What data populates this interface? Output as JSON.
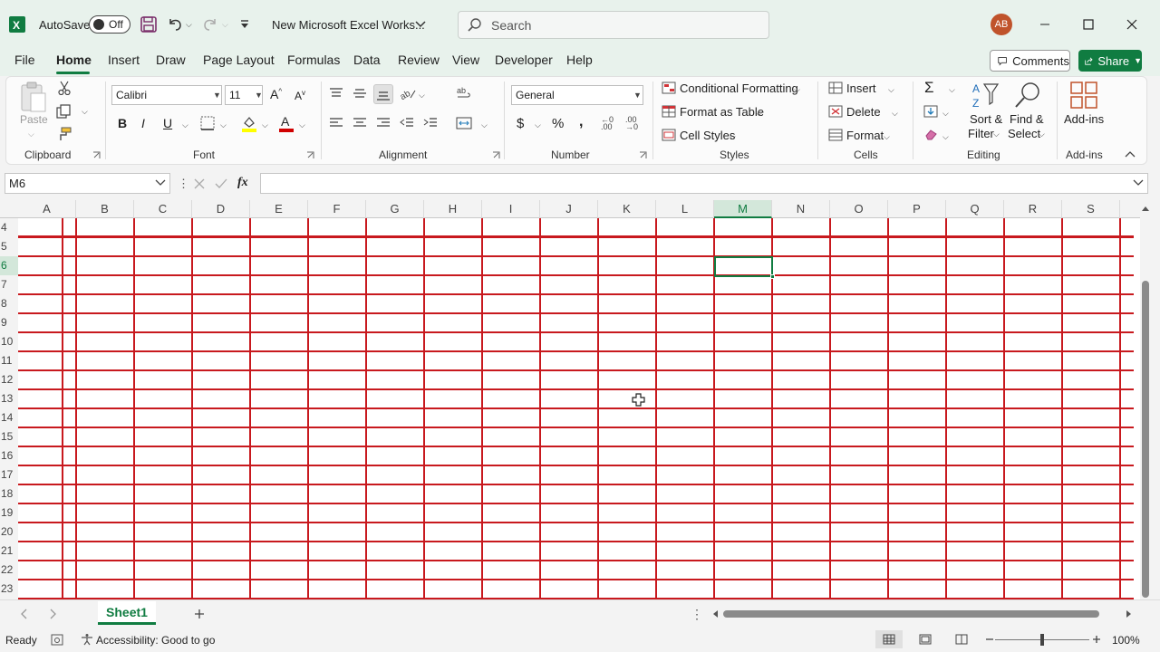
{
  "titlebar": {
    "autosave_label": "AutoSave",
    "autosave_state": "Off",
    "doc_title": "New Microsoft Excel Works...",
    "search_placeholder": "Search",
    "avatar_initials": "AB"
  },
  "menu": {
    "tabs": [
      "File",
      "Home",
      "Insert",
      "Draw",
      "Page Layout",
      "Formulas",
      "Data",
      "Review",
      "View",
      "Developer",
      "Help"
    ],
    "active": "Home",
    "comments_label": "Comments",
    "share_label": "Share"
  },
  "ribbon": {
    "clipboard": {
      "paste": "Paste",
      "label": "Clipboard"
    },
    "font": {
      "family": "Calibri",
      "size": "11",
      "label": "Font"
    },
    "alignment": {
      "label": "Alignment"
    },
    "number": {
      "format": "General",
      "label": "Number"
    },
    "styles": {
      "conditional": "Conditional Formatting",
      "format_table": "Format as Table",
      "cell_styles": "Cell Styles",
      "label": "Styles"
    },
    "cells": {
      "insert": "Insert",
      "delete": "Delete",
      "format": "Format",
      "label": "Cells"
    },
    "editing": {
      "sort_1": "Sort &",
      "sort_2": "Filter",
      "find_1": "Find &",
      "find_2": "Select",
      "label": "Editing"
    },
    "addins": {
      "button": "Add-ins",
      "label": "Add-ins"
    }
  },
  "formula_bar": {
    "name_box": "M6",
    "fx": "fx",
    "value": ""
  },
  "grid": {
    "columns": [
      "A",
      "B",
      "C",
      "D",
      "E",
      "F",
      "G",
      "H",
      "I",
      "J",
      "K",
      "L",
      "M",
      "N",
      "O",
      "P",
      "Q",
      "R",
      "S"
    ],
    "rows": [
      "4",
      "5",
      "6",
      "7",
      "8",
      "9",
      "10",
      "11",
      "12",
      "13",
      "14",
      "15",
      "16",
      "17",
      "18",
      "19",
      "20",
      "21",
      "22",
      "23"
    ],
    "selected_cell": "M6",
    "gridline_color": "#c8191e"
  },
  "sheets": {
    "tabs": [
      "Sheet1"
    ]
  },
  "status": {
    "ready": "Ready",
    "accessibility": "Accessibility: Good to go",
    "zoom": "100%"
  },
  "colors": {
    "accent": "#107c41"
  }
}
